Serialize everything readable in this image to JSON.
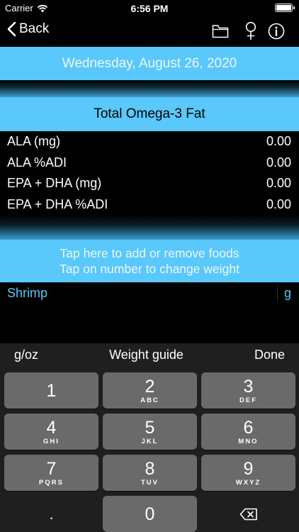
{
  "status": {
    "carrier": "Carrier",
    "time": "6:56 PM"
  },
  "nav": {
    "back_label": "Back",
    "icons": [
      "folder-icon",
      "female-symbol-icon",
      "info-icon"
    ]
  },
  "date": "Wednesday, August 26, 2020",
  "section_title": "Total Omega-3 Fat",
  "nutrients": [
    {
      "label": "ALA (mg)",
      "value": "0.00"
    },
    {
      "label": "ALA %ADI",
      "value": "0.00"
    },
    {
      "label": "EPA + DHA (mg)",
      "value": "0.00"
    },
    {
      "label": "EPA + DHA %ADI",
      "value": "0.00"
    }
  ],
  "hint": {
    "line1": "Tap here to add or remove foods",
    "line2": "Tap on number to change weight"
  },
  "food": {
    "name": "Shrimp",
    "unit": "g"
  },
  "accent_color": "#5ac8fa",
  "keyboard": {
    "toolbar": {
      "left": "g/oz",
      "center": "Weight guide",
      "right": "Done"
    },
    "keys": [
      {
        "digit": "1",
        "letters": ""
      },
      {
        "digit": "2",
        "letters": "ABC"
      },
      {
        "digit": "3",
        "letters": "DEF"
      },
      {
        "digit": "4",
        "letters": "GHI"
      },
      {
        "digit": "5",
        "letters": "JKL"
      },
      {
        "digit": "6",
        "letters": "MNO"
      },
      {
        "digit": "7",
        "letters": "PQRS"
      },
      {
        "digit": "8",
        "letters": "TUV"
      },
      {
        "digit": "9",
        "letters": "WXYZ"
      },
      {
        "digit": ".",
        "letters": ""
      },
      {
        "digit": "0",
        "letters": ""
      }
    ]
  }
}
